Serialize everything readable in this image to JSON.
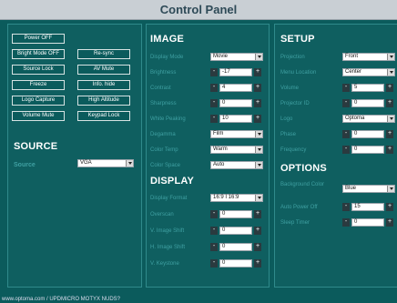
{
  "title": "Control Panel",
  "quick_buttons": [
    "Power OFF",
    "Bright Mode OFF",
    "Re-sync",
    "Source Lock",
    "AV Mute",
    "Freeze",
    "Info. hide",
    "Logo Capture",
    "High Altitude",
    "Volume Mute",
    "Keypad Lock"
  ],
  "source": {
    "heading": "SOURCE",
    "label": "Source",
    "value": "VGA"
  },
  "image": {
    "heading": "IMAGE",
    "rows": [
      {
        "label": "Display Mode",
        "type": "select",
        "value": "Movie"
      },
      {
        "label": "Brightness",
        "type": "stepper",
        "value": "-17"
      },
      {
        "label": "Contrast",
        "type": "stepper",
        "value": "4"
      },
      {
        "label": "Sharpness",
        "type": "stepper",
        "value": "0"
      },
      {
        "label": "White Peaking",
        "type": "stepper",
        "value": "10"
      },
      {
        "label": "Degamma",
        "type": "select",
        "value": "Film"
      },
      {
        "label": "Color Temp",
        "type": "select",
        "value": "Warm"
      },
      {
        "label": "Color Space",
        "type": "select",
        "value": "Auto"
      }
    ]
  },
  "display": {
    "heading": "DISPLAY",
    "rows": [
      {
        "label": "Display Format",
        "type": "select",
        "value": "16:9 I 16:9"
      },
      {
        "label": "Overscan",
        "type": "stepper",
        "value": "0"
      },
      {
        "label": "V. Image Shift",
        "type": "stepper",
        "value": "0"
      },
      {
        "label": "H. Image Shift",
        "type": "stepper",
        "value": "0"
      },
      {
        "label": "V. Keystone",
        "type": "stepper",
        "value": "0"
      }
    ]
  },
  "setup": {
    "heading": "SETUP",
    "rows": [
      {
        "label": "Projection",
        "type": "select",
        "value": "Front"
      },
      {
        "label": "Menu Location",
        "type": "select",
        "value": "Center"
      },
      {
        "label": "Volume",
        "type": "stepper",
        "value": "5"
      },
      {
        "label": "Projector ID",
        "type": "stepper",
        "value": "0"
      },
      {
        "label": "Logo",
        "type": "select",
        "value": "Optoma"
      },
      {
        "label": "Phase",
        "type": "stepper",
        "value": "0"
      },
      {
        "label": "Frequency",
        "type": "stepper",
        "value": "0"
      }
    ]
  },
  "options": {
    "heading": "OPTIONS",
    "rows": [
      {
        "label": "Background Color",
        "type": "select",
        "value": "Blue"
      },
      {
        "label": "Auto Power Off",
        "type": "stepper",
        "value": "15"
      },
      {
        "label": "Sleep Timer",
        "type": "stepper",
        "value": "0"
      }
    ]
  },
  "status_bar": "www.optoma.com / UPDMICRO MOTYX NUDS?"
}
